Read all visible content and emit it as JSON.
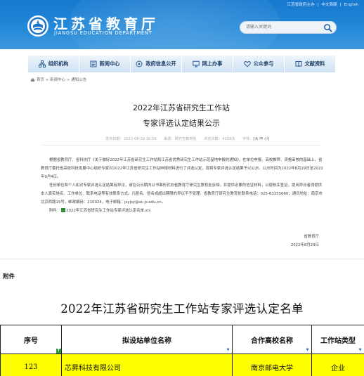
{
  "header": {
    "top_links": [
      "江苏省政府主办",
      "中文简版",
      "English"
    ],
    "site_title": "江苏省教育厅",
    "site_subtitle": "JIANGSU EDUCATION DEPARTMENT",
    "search_placeholder": "请输入关键词",
    "search_icon": "search-icon"
  },
  "nav": {
    "items": [
      {
        "label": "组织机构",
        "icon": "org-icon"
      },
      {
        "label": "新闻中心",
        "icon": "news-icon"
      },
      {
        "label": "政府信息公开",
        "icon": "info-icon"
      },
      {
        "label": "网上办事",
        "icon": "monitor-icon"
      },
      {
        "label": "公众参与",
        "icon": "heart-icon"
      },
      {
        "label": "文献资料",
        "icon": "book-icon"
      }
    ]
  },
  "breadcrumb": {
    "text": "首页 > 新闻中心 > 通知公告"
  },
  "article": {
    "title_line1": "2022年江苏省研究生工作站",
    "title_line2": "专家评选认定结果公示",
    "meta_left": "发布日期：2022-08-29 16:59　　来源：研究生教育处　　浏览次数：4209次　　字体：",
    "meta_font_sizes": "[大 中 小]",
    "para1": "根据省教育厅、省科技厅《关于做好2022年江苏省研究生工作站和江苏省优秀研究生工作站示范基地申报的通知》，在单位申报、高校推荐、资格审核的基础上，省教育厅委托省高校科技发展中心组织专家对2022年江苏省研究生工作站申报材料进行了评选认定，现将专家评选认定结果予以公示。公示时间为2022年8月29日至2022年9月4日。",
    "para2": "任何单位和个人如对专家评选认定结果有异议，请在公示期内以书面形式向省教育厅研究生教育处反映，并提供必要的佐证材料，以便核实查证。提出异议者须提供本人真实姓名、工作单位、联系电话等有效联系方式。凡匿名、冒名或超出期限的异议不予受理。省教育厅研究生教育处联系电话：025-83335660；通讯地址：南京市北京西路15号，邮政编码：210024，电子邮箱：jsyjsy@ec.js.edu.cn。",
    "attachment_label": "附件：",
    "attachment_file": "2022年江苏省研究生工作站专家评选认定名单.xls",
    "sign_org": "省教育厅",
    "sign_date": "2022年8月29日"
  },
  "attachment_section": {
    "label": "附件",
    "list_title": "2022年江苏省研究生工作站专家评选认定名单",
    "columns": [
      "序号",
      "拟设站单位名称",
      "合作高校名称",
      "工作站类型"
    ],
    "rows": [
      {
        "no": "123",
        "company": "芯昇科技有限公司",
        "university": "南京邮电大学",
        "type": "企业"
      }
    ],
    "highlight_color": "#fefe00"
  }
}
